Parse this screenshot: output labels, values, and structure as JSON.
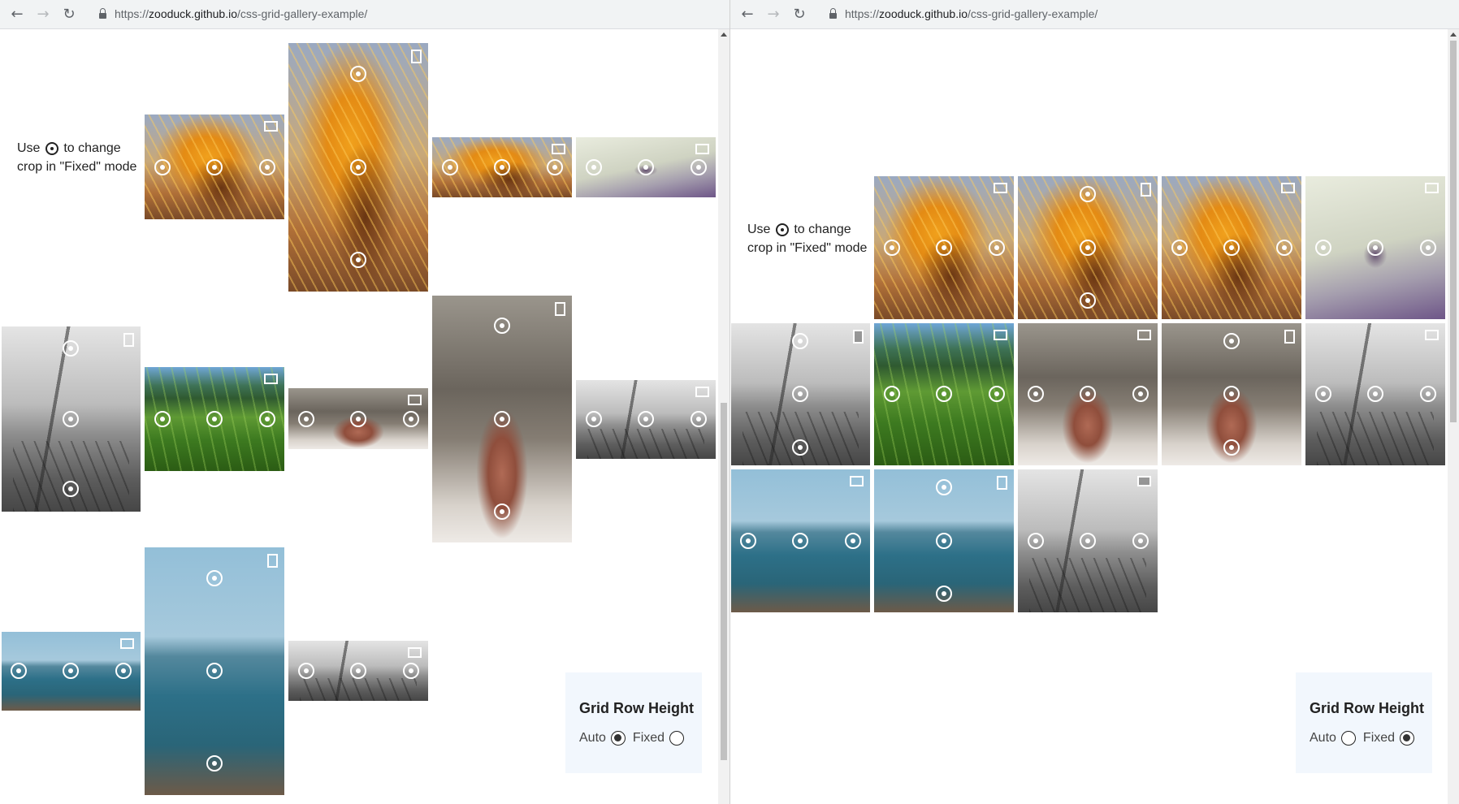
{
  "panels": [
    {
      "url_host": "zooduck.github.io",
      "url_path": "/css-grid-gallery-example/",
      "caption": {
        "pre": "Use",
        "post": "to change crop in \"Fixed\" mode"
      },
      "control": {
        "title": "Grid Row Height",
        "auto_label": "Auto",
        "fixed_label": "Fixed",
        "selected": "Auto"
      },
      "scroll_thumb_fraction": 0.52,
      "tiles": [
        "cactus",
        "cactus-tall",
        "cactus",
        "seabird",
        "jetty",
        "grass",
        "nose",
        "nose-tall",
        "jetty",
        "sea",
        "sea-tall",
        "jetty"
      ]
    },
    {
      "url_host": "zooduck.github.io",
      "url_path": "/css-grid-gallery-example/",
      "caption": {
        "pre": "Use",
        "post": "to change crop in \"Fixed\" mode"
      },
      "control": {
        "title": "Grid Row Height",
        "auto_label": "Auto",
        "fixed_label": "Fixed",
        "selected": "Fixed"
      },
      "scroll_thumb_fraction": 0.48,
      "tiles": [
        "cactus",
        "cactus",
        "cactus",
        "seabird",
        "jetty",
        "grass",
        "nose",
        "nose",
        "jetty",
        "sea",
        "sea",
        "jetty"
      ]
    }
  ],
  "icons": {
    "back": "back-arrow-icon",
    "forward": "forward-arrow-icon",
    "reload": "reload-icon",
    "lock": "lock-icon",
    "crop_toggle": "crop-toggle-icon",
    "focus_target": "focus-target-icon"
  }
}
